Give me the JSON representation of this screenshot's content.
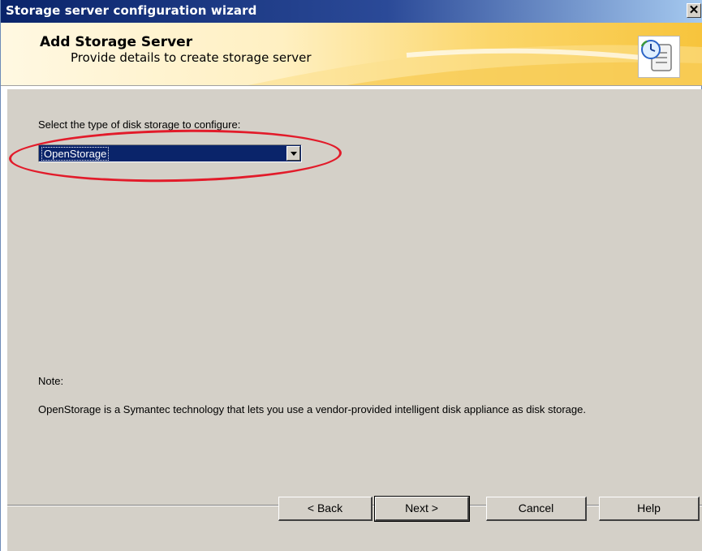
{
  "window": {
    "title": "Storage server configuration wizard",
    "close_glyph": "✕"
  },
  "header": {
    "title": "Add Storage Server",
    "subtitle": "Provide details to create storage server",
    "icon": "wizard-scroll-clock-icon"
  },
  "form": {
    "select_label": "Select the type of disk storage to configure:",
    "storage_type": {
      "selected": "OpenStorage"
    }
  },
  "note": {
    "label": "Note:",
    "text": "OpenStorage is a Symantec technology that lets you use a vendor-provided intelligent disk appliance as disk storage."
  },
  "buttons": {
    "back": "< Back",
    "next": "Next >",
    "cancel": "Cancel",
    "help": "Help"
  },
  "colors": {
    "annotation_red": "#e21b2a",
    "selection_blue": "#0a246a",
    "dialog_gray": "#d4d0c8"
  }
}
